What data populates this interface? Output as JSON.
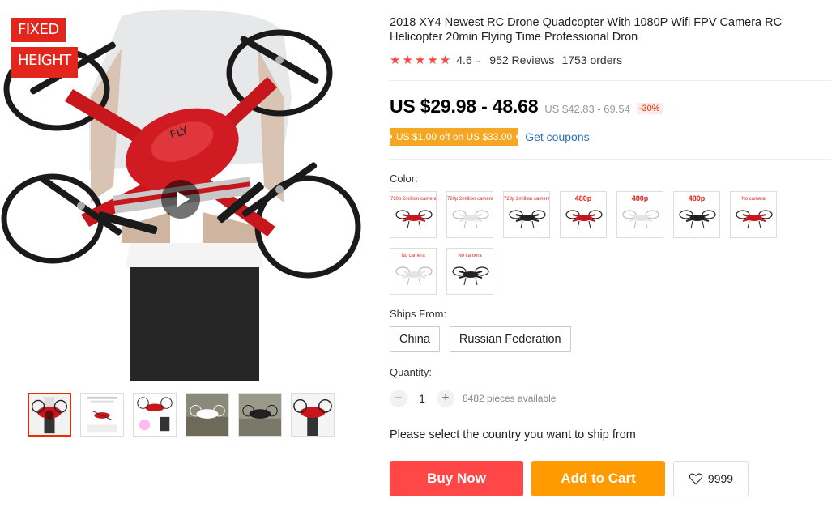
{
  "product": {
    "title": "2018 XY4 Newest RC Drone Quadcopter With 1080P Wifi FPV Camera RC Helicopter 20min Flying Time Professional Dron",
    "rating": "4.6",
    "reviews": "952 Reviews",
    "orders": "1753 orders",
    "stars": 5
  },
  "gallery": {
    "badge_line1": "FIXED",
    "badge_line2": "HEIGHT",
    "thumbnails": 6,
    "active_thumb": 0
  },
  "pricing": {
    "price": "US $29.98 - 48.68",
    "old_price": "US $42.83 - 69.54",
    "discount": "-30%",
    "coupon": "US $1.00 off on US $33.00",
    "get_coupons": "Get coupons"
  },
  "options": {
    "color_label": "Color:",
    "color_swatches": [
      {
        "caption": "720p 2million camera",
        "drone": "red"
      },
      {
        "caption": "720p 2million camera",
        "drone": "white"
      },
      {
        "caption": "720p 2million camera",
        "drone": "black"
      },
      {
        "caption": "480p",
        "drone": "red"
      },
      {
        "caption": "480p",
        "drone": "white"
      },
      {
        "caption": "480p",
        "drone": "black"
      },
      {
        "caption": "No camera",
        "drone": "red"
      },
      {
        "caption": "No camera",
        "drone": "white"
      },
      {
        "caption": "No camera",
        "drone": "black"
      }
    ],
    "ships_from_label": "Ships From:",
    "ships_from": [
      "China",
      "Russian Federation"
    ],
    "quantity_label": "Quantity:",
    "quantity_minus": "−",
    "quantity_plus": "+",
    "quantity": "1",
    "available": "8482 pieces available",
    "ship_note": "Please select the country you want to ship from"
  },
  "actions": {
    "buy_now": "Buy Now",
    "add_to_cart": "Add to Cart",
    "wishlist_count": "9999"
  },
  "colors": {
    "accent_red": "#ff4747",
    "cart_orange": "#ff9a00",
    "coupon_orange": "#f5a623",
    "link_blue": "#2e6fb8"
  }
}
